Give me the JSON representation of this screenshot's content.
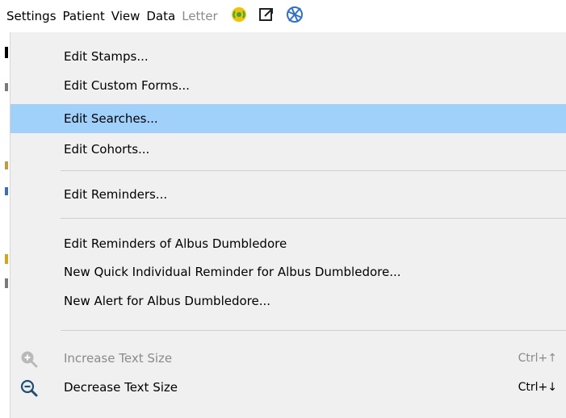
{
  "menubar": {
    "settings": "Settings",
    "patient": "Patient",
    "view": "View",
    "data": "Data",
    "letter": "Letter"
  },
  "menu": {
    "items": [
      {
        "label": "Edit Stamps..."
      },
      {
        "label": "Edit Custom Forms..."
      },
      {
        "label": "Edit Searches..."
      },
      {
        "label": "Edit Cohorts..."
      },
      {
        "label": "Edit Reminders..."
      },
      {
        "label": "Edit Reminders of Albus Dumbledore"
      },
      {
        "label": "New Quick Individual Reminder for Albus Dumbledore..."
      },
      {
        "label": "New Alert for Albus Dumbledore..."
      },
      {
        "label": "Increase Text Size",
        "shortcut": "Ctrl+↑",
        "disabled": true
      },
      {
        "label": "Decrease Text Size",
        "shortcut": "Ctrl+↓"
      }
    ]
  },
  "colors": {
    "highlight": "#9fd1fb",
    "menu_bg": "#f0f0f0",
    "disabled_text": "#8a8a8a",
    "accent_blue": "#2d6fd8",
    "signal_green": "#2ea84a",
    "sun_yellow": "#f2c200"
  }
}
